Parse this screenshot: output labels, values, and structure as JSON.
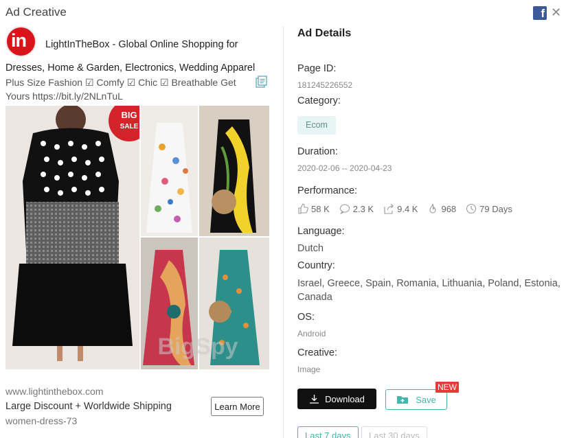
{
  "modal": {
    "title": "Ad Creative"
  },
  "ad": {
    "advertiser": "LightInTheBox - Global Online Shopping for Dresses, Home & Garden, Electronics, Wedding Apparel",
    "avatar_text": "in",
    "text": "Plus Size Fashion ☑ Comfy ☑ Chic ☑ Breathable Get Yours https://bit.ly/2NLnTuL",
    "creative_badge": "BIG SALE",
    "watermark": "BigSpy",
    "site_url": "www.lightinthebox.com",
    "headline": "Large Discount + Worldwide Shipping",
    "slug": "women-dress-73",
    "cta_label": "Learn More"
  },
  "details": {
    "title": "Ad Details",
    "page_id_label": "Page ID:",
    "page_id": "181245226552",
    "category_label": "Category:",
    "category": "Ecom",
    "duration_label": "Duration:",
    "duration": "2020-02-06 -- 2020-04-23",
    "performance_label": "Performance:",
    "performance": {
      "likes": "58 K",
      "comments": "2.3 K",
      "shares": "9.4 K",
      "hot": "968",
      "days": "79 Days"
    },
    "language_label": "Language:",
    "language": "Dutch",
    "country_label": "Country:",
    "countries": "Israel, Greece, Spain, Romania, Lithuania, Poland, Estonia, Canada",
    "os_label": "OS:",
    "os": "Android",
    "creative_label": "Creative:",
    "creative": "Image"
  },
  "actions": {
    "download_label": "Download",
    "save_label": "Save",
    "new_badge": "NEW"
  },
  "tabs": [
    "Last 7 days",
    "Last 30 days"
  ],
  "colors": {
    "accent": "#45b5ad",
    "new_badge": "#e53a3a",
    "brand_red": "#d9141b"
  }
}
